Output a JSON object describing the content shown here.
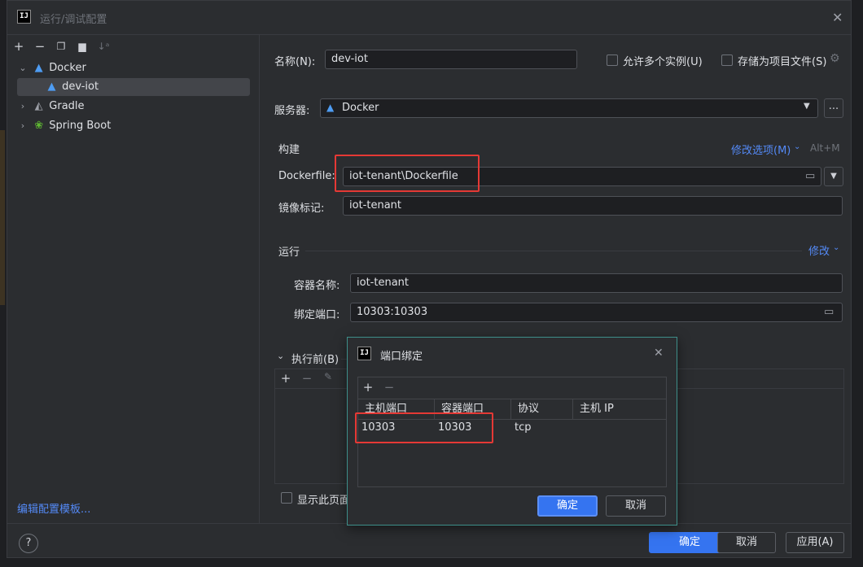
{
  "window": {
    "title": "运行/调试配置",
    "logo": "IJ"
  },
  "toolbar": {
    "icons": [
      "add-icon",
      "remove-icon",
      "copy-icon",
      "folder-add-icon",
      "sort-icon"
    ]
  },
  "tree": {
    "items": [
      {
        "label": "Docker",
        "icon": "docker-icon",
        "expanded": true
      },
      {
        "label": "dev-iot",
        "icon": "docker-icon",
        "selected": true
      },
      {
        "label": "Gradle",
        "icon": "gradle-icon",
        "expanded": false
      },
      {
        "label": "Spring Boot",
        "icon": "spring-boot-icon",
        "expanded": false
      }
    ],
    "edit_templates_link": "编辑配置模板..."
  },
  "form": {
    "name_label": "名称(N):",
    "name_value": "dev-iot",
    "allow_multiple": "允许多个实例(U)",
    "store_as_file": "存储为项目文件(S)",
    "server_label": "服务器:",
    "server_value": "Docker",
    "build_section": "构建",
    "modify_options": "修改选项(M)",
    "modify_shortcut": "Alt+M",
    "dockerfile_label": "Dockerfile:",
    "dockerfile_value": "iot-tenant\\Dockerfile",
    "image_tag_label": "镜像标记:",
    "image_tag_value": "iot-tenant",
    "run_section": "运行",
    "run_modify": "修改",
    "container_name_label": "容器名称:",
    "container_name_value": "iot-tenant",
    "bind_ports_label": "绑定端口:",
    "bind_ports_value": "10303:10303",
    "before_launch": "执行前(B)",
    "show_page": "显示此页面"
  },
  "buttons": {
    "ok": "确定",
    "cancel": "取消",
    "apply": "应用(A)",
    "help": "?"
  },
  "popup": {
    "title": "端口绑定",
    "columns": [
      "主机端口",
      "容器端口",
      "协议",
      "主机 IP"
    ],
    "rows": [
      {
        "host_port": "10303",
        "container_port": "10303",
        "protocol": "tcp",
        "host_ip": ""
      }
    ],
    "ok": "确定",
    "cancel": "取消"
  },
  "colors": {
    "accent": "#3574f0",
    "highlight_box": "#e53935",
    "link": "#548af7",
    "popup_border": "#3e8f8a"
  }
}
